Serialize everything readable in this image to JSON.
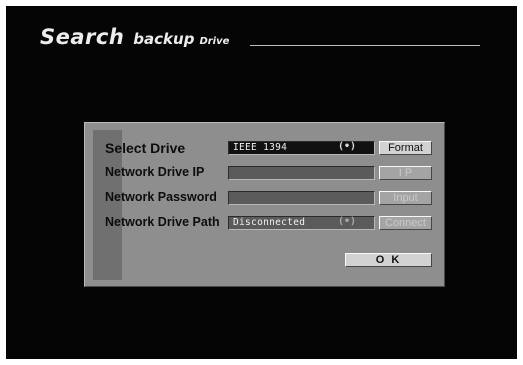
{
  "header": {
    "title_word1": "Search",
    "title_word2": "backup",
    "title_word3": "Drive"
  },
  "dialog": {
    "select_drive": {
      "label": "Select Drive",
      "value": "IEEE 1394",
      "signal_icon": "(•)",
      "button": "Format"
    },
    "network_ip": {
      "label": "Network Drive IP",
      "value": "",
      "button": "I P"
    },
    "network_password": {
      "label": "Network Password",
      "value": "",
      "button": "Input"
    },
    "network_path": {
      "label": "Network Drive Path",
      "value": "Disconnected",
      "signal_icon": "(•)",
      "button": "Connect"
    },
    "ok_label": "O K"
  }
}
